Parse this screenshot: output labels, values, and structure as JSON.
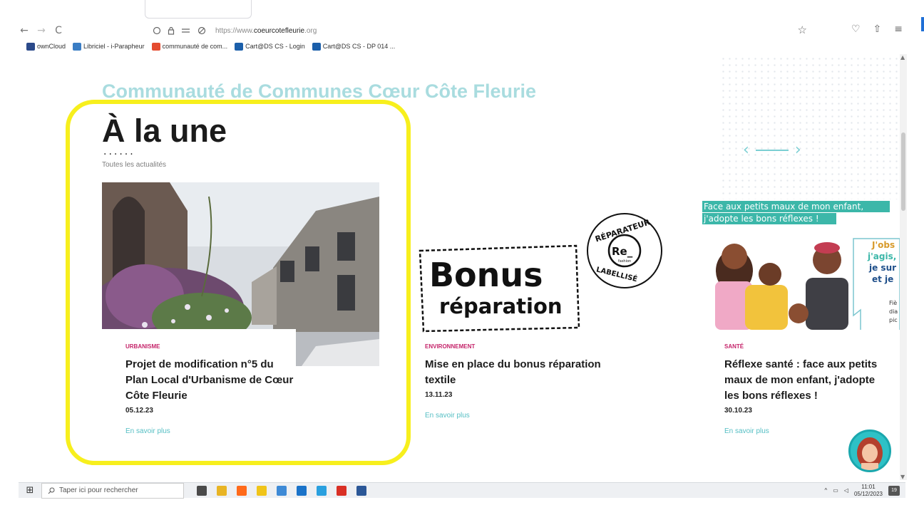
{
  "browser": {
    "url_prefix": "https://www.",
    "url_domain": "coeurcotefleurie",
    "url_suffix": ".org",
    "nav": {
      "back_icon": "←",
      "forward_icon": "→",
      "reload_icon": "C"
    },
    "bookmarks": [
      {
        "label": "ownCloud",
        "color": "#2b4a8a"
      },
      {
        "label": "Libriciel - i-Parapheur",
        "color": "#3a7dc4"
      },
      {
        "label": "communauté de com...",
        "color": "#e44b2f"
      },
      {
        "label": "Cart@DS CS - Login",
        "color": "#1b5faa"
      },
      {
        "label": "Cart@DS CS - DP 014 ...",
        "color": "#1b5faa"
      }
    ]
  },
  "page": {
    "site_title": "Communauté de Communes Cœur Côte Fleurie",
    "headline": "À la une",
    "dots": "......",
    "all_news_link": "Toutes les actualités"
  },
  "cards": [
    {
      "category": "URBANISME",
      "title": "Projet de modification n°5 du Plan Local d'Urbanisme de Cœur Côte Fleurie",
      "date": "05.12.23",
      "more": "En savoir plus"
    },
    {
      "category": "ENVIRONNEMENT",
      "title": "Mise en place du bonus réparation textile",
      "date": "13.11.23",
      "more": "En savoir plus",
      "image_text": {
        "bonus_word": "Bonus",
        "reparation_word": "réparation",
        "badge_top": "RÉPARATEUR",
        "badge_bottom": "LABELLISÉ",
        "badge_logo": "Re_",
        "badge_sub": "fashion"
      }
    },
    {
      "category": "SANTÉ",
      "title": "Réflexe santé : face aux petits maux de mon enfant, j'adopte les bons réflexes !",
      "date": "30.10.23",
      "more": "En savoir plus",
      "image_text": {
        "banner_line1": "Face aux petits maux de mon enfant,",
        "banner_line2": "j'adopte les bons réflexes !",
        "side1": "J'obs",
        "side2": "j'agis,",
        "side3": "je sur",
        "side4": "et je",
        "small1": "Fiè",
        "small2": "dia",
        "small3": "pic"
      }
    }
  ],
  "taskbar": {
    "search_placeholder": "Taper ici pour rechercher",
    "time": "11:01",
    "date": "05/12/2023",
    "notif_count": "19",
    "apps": [
      {
        "name": "task-view",
        "color": "#4a4a4a"
      },
      {
        "name": "file-explorer",
        "color": "#e8b424"
      },
      {
        "name": "firefox",
        "color": "#ff6a1a"
      },
      {
        "name": "sticky-notes",
        "color": "#f0c419"
      },
      {
        "name": "paint",
        "color": "#3e8ad6"
      },
      {
        "name": "outlook",
        "color": "#1a73c9"
      },
      {
        "name": "wifi",
        "color": "#2aa0df"
      },
      {
        "name": "chrome",
        "color": "#d93025"
      },
      {
        "name": "word",
        "color": "#2b5797"
      }
    ]
  }
}
